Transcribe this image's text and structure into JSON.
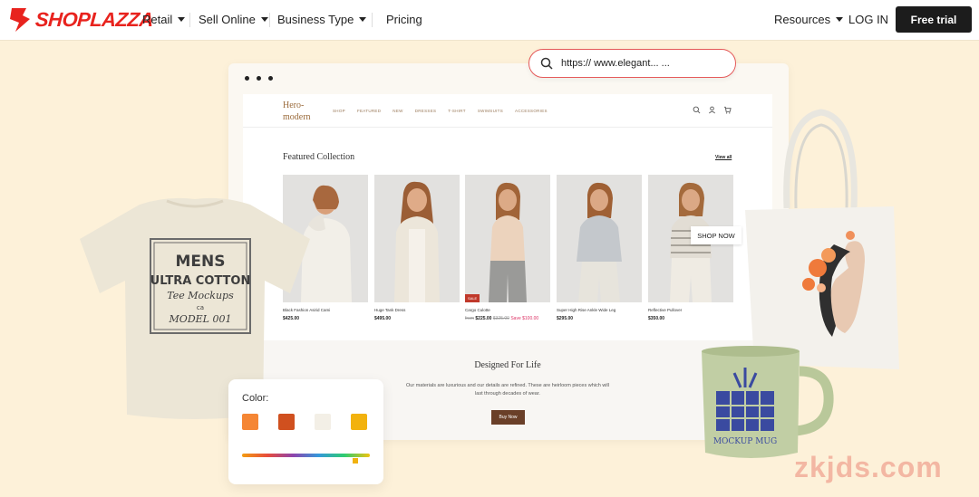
{
  "nav": {
    "brand": "SHOPLAZZA",
    "items": [
      {
        "label": "Retail"
      },
      {
        "label": "Sell Online"
      },
      {
        "label": "Business Type"
      },
      {
        "label": "Pricing"
      }
    ],
    "resources": "Resources",
    "login": "LOG IN",
    "cta": "Free trial"
  },
  "url": {
    "text": "https:// www.elegant... ..."
  },
  "site": {
    "logo_line1": "Hero-",
    "logo_line2": "modern",
    "menu": [
      "SHOP",
      "FEATURED",
      "NEW",
      "DRESSES",
      "T-SHIRT",
      "SWIMSUITS",
      "ACCESSORIES"
    ],
    "featured_title": "Featured Collection",
    "view_all": "View all",
    "products": [
      {
        "name": "Black Fashion Asirid Cami",
        "price": "$425.00"
      },
      {
        "name": "Huge Tank Dress",
        "price": "$495.00"
      },
      {
        "name": "Cargo Culotte",
        "prefix": "from",
        "price": "$225.00",
        "old": "$325.00",
        "save": "Save $100.00",
        "badge": "SALE"
      },
      {
        "name": "Super High Rise Ankle Wide Leg",
        "price": "$295.00"
      },
      {
        "name": "Reflective Pullover",
        "price": "$350.00"
      }
    ],
    "shop_now": "SHOP NOW",
    "designed_title": "Designed For Life",
    "designed_body": "Our materials are luxurious and our details are refined. These are heirloom pieces which will last through decades of wear.",
    "buy_now": "Buy Now"
  },
  "tshirt": {
    "line1": "MENS",
    "line2": "ULTRA COTTON",
    "line3": "Tee Mockups",
    "line4": "ca",
    "line5": "MODEL 001"
  },
  "mug": {
    "label": "MOCKUP MUG"
  },
  "color_card": {
    "label": "Color:",
    "swatches": [
      "#f58634",
      "#d0501f",
      "#f3efe6",
      "#f2b20e"
    ],
    "slider_position": 0.9
  },
  "watermark": "zkjds.com"
}
